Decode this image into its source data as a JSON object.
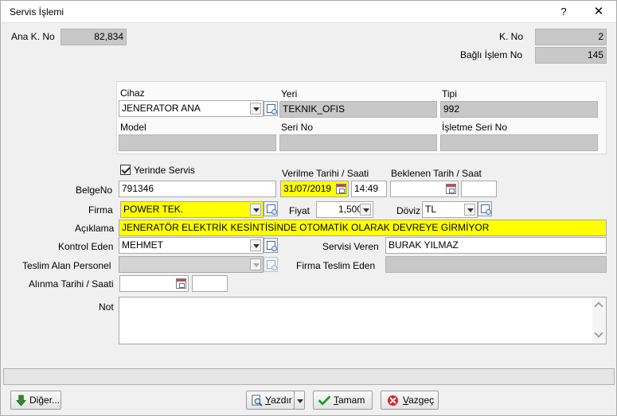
{
  "window": {
    "title": "Servis İşlemi",
    "help_button": "?",
    "close_button": "✕"
  },
  "header": {
    "ana_k_no_label": "Ana K. No",
    "ana_k_no_value": "82,834",
    "k_no_label": "K. No",
    "k_no_value": "2",
    "bagli_islem_no_label": "Bağlı İşlem No",
    "bagli_islem_no_value": "145"
  },
  "device": {
    "cihaz_label": "Cihaz",
    "cihaz_value": "JENERATOR ANA",
    "yeri_label": "Yeri",
    "yeri_value": "TEKNIK_OFIS",
    "tipi_label": "Tipi",
    "tipi_value": "992",
    "model_label": "Model",
    "model_value": "",
    "seri_no_label": "Seri No",
    "seri_no_value": "",
    "isletme_seri_no_label": "İşletme Seri No",
    "isletme_seri_no_value": ""
  },
  "form": {
    "yerinde_servis_label": "Yerinde Servis",
    "yerinde_servis_checked": true,
    "verilme_label": "Verilme Tarihi / Saati",
    "verilme_date": "31/07/2019",
    "verilme_time": "14:49",
    "beklenen_label": "Beklenen Tarih / Saat",
    "beklenen_date": "",
    "beklenen_time": "",
    "belge_no_label": "BelgeNo",
    "belge_no_value": "791346",
    "firma_label": "Firma",
    "firma_value": "POWER TEK.",
    "fiyat_label": "Fiyat",
    "fiyat_value": "1,500",
    "doviz_label": "Döviz",
    "doviz_value": "TL",
    "aciklama_label": "Açıklama",
    "aciklama_value": "JENERATÖR ELEKTRİK KESİNTİSİNDE OTOMATİK OLARAK DEVREYE GİRMİYOR",
    "kontrol_eden_label": "Kontrol Eden",
    "kontrol_eden_value": "MEHMET",
    "servisi_veren_label": "Servisi Veren",
    "servisi_veren_value": "BURAK YILMAZ",
    "teslim_alan_label": "Teslim Alan Personel",
    "teslim_alan_value": "",
    "firma_teslim_eden_label": "Firma Teslim Eden",
    "firma_teslim_eden_value": "",
    "alinma_label": "Alınma Tarihi / Saati",
    "alinma_date": "",
    "alinma_time": "",
    "not_label": "Not",
    "not_value": ""
  },
  "buttons": {
    "diger_pre": "Di",
    "diger_u": "ğ",
    "diger_post": "er...",
    "yazdir_u": "Y",
    "yazdir_post": "azdır",
    "tamam_u": "T",
    "tamam_post": "amam",
    "vazgec_u": "V",
    "vazgec_post": "azgeç"
  },
  "colors": {
    "required_field": "#ffff00",
    "readonly_field": "#d4d4d4"
  }
}
